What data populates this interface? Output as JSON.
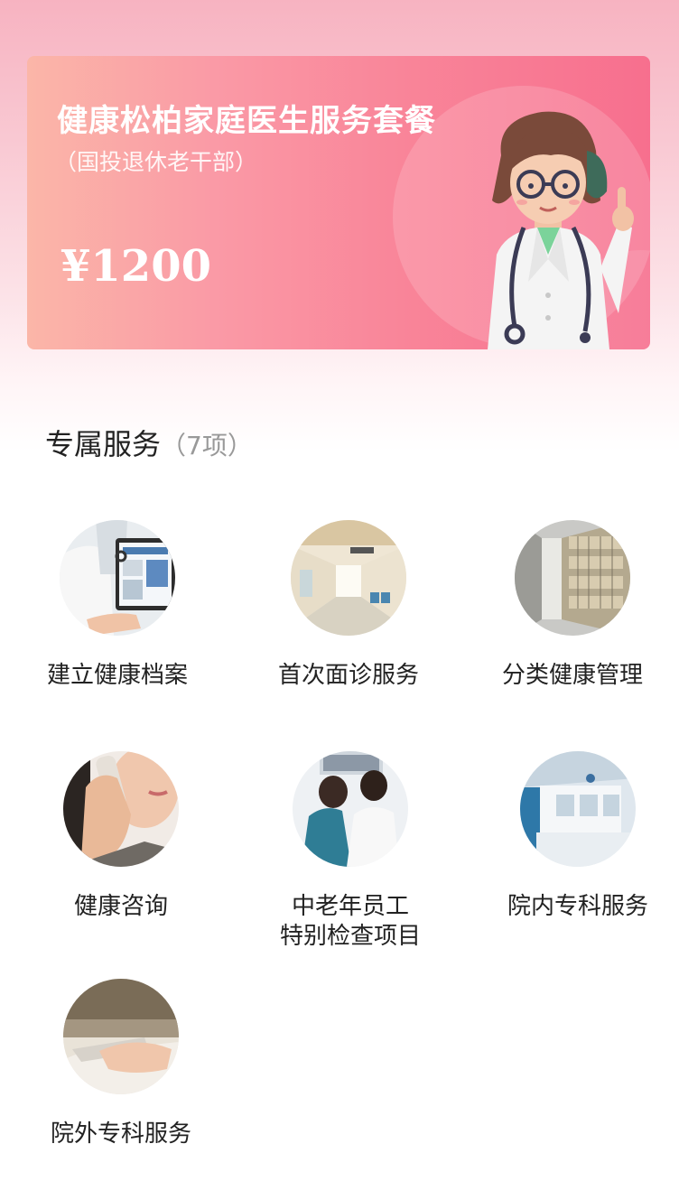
{
  "banner": {
    "title": "健康松柏家庭医生服务套餐",
    "subtitle": "（国投退休老干部）",
    "price": "¥1200",
    "illustration": "doctor-illustration"
  },
  "section": {
    "title": "专属服务",
    "count": "（7项）"
  },
  "services": [
    {
      "label": "建立健康档案",
      "image": "doctor-tablet-photo"
    },
    {
      "label": "首次面诊服务",
      "image": "hospital-corridor-photo"
    },
    {
      "label": "分类健康管理",
      "image": "records-shelves-photo"
    },
    {
      "label": "健康咨询",
      "image": "phone-call-photo"
    },
    {
      "label_line1": "中老年员工",
      "label_line2": "特别检查项目",
      "image": "doctors-xray-photo"
    },
    {
      "label": "院内专科服务",
      "image": "hospital-reception-photo"
    },
    {
      "label": "院外专科服务",
      "image": "smartphone-hand-photo"
    }
  ],
  "colors": {
    "banner_start": "#fbb6a8",
    "banner_end": "#f76f8e",
    "text_primary": "#222222",
    "text_secondary": "#999999"
  }
}
